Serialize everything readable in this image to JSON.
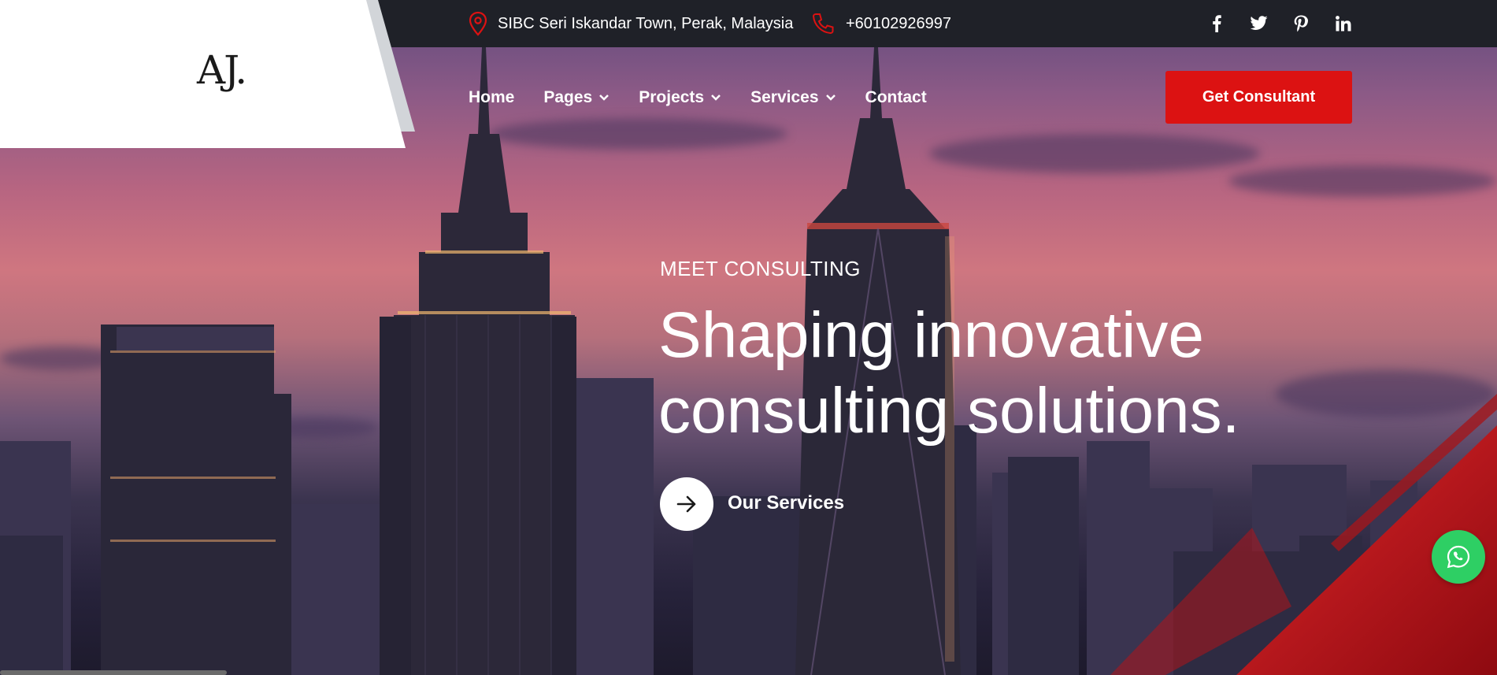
{
  "topbar": {
    "address": "SIBC Seri Iskandar Town, Perak, Malaysia",
    "phone": "+60102926997",
    "social": [
      "facebook-icon",
      "twitter-icon",
      "pinterest-icon",
      "linkedin-icon"
    ]
  },
  "logo": {
    "text": "AJ."
  },
  "nav": {
    "items": [
      {
        "label": "Home",
        "has_dropdown": false
      },
      {
        "label": "Pages",
        "has_dropdown": true
      },
      {
        "label": "Projects",
        "has_dropdown": true
      },
      {
        "label": "Services",
        "has_dropdown": true
      },
      {
        "label": "Contact",
        "has_dropdown": false
      }
    ],
    "cta_label": "Get Consultant"
  },
  "hero": {
    "eyebrow": "MEET CONSULTING",
    "headline_line1": "Shaping innovative",
    "headline_line2": "consulting solutions.",
    "services_label": "Our Services"
  },
  "colors": {
    "accent": "#dc1212",
    "topbar": "#1f2128",
    "whatsapp": "#2ecf64"
  }
}
